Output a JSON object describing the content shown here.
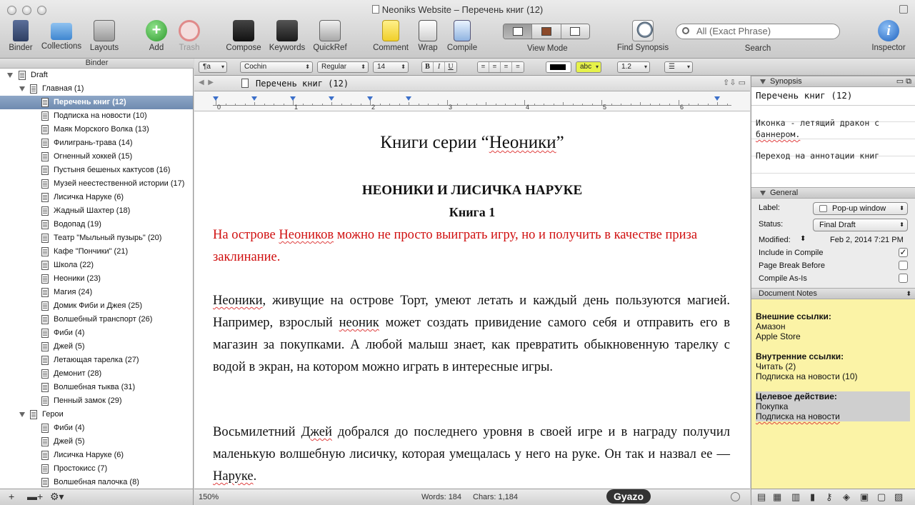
{
  "window": {
    "title": "Neoniks Website – Перечень книг (12)"
  },
  "toolbar": {
    "binder": "Binder",
    "collections": "Collections",
    "layouts": "Layouts",
    "add": "Add",
    "trash": "Trash",
    "compose": "Compose",
    "keywords": "Keywords",
    "quickref": "QuickRef",
    "comment": "Comment",
    "wrap": "Wrap",
    "compile": "Compile",
    "view_mode": "View Mode",
    "find_synopsis": "Find Synopsis",
    "search_placeholder": "All (Exact Phrase)",
    "search": "Search",
    "inspector": "Inspector"
  },
  "binder": {
    "header": "Binder",
    "draft": "Draft",
    "main_folder": "Главная (1)",
    "items": [
      "Перечень книг (12)",
      "Подписка на новости (10)",
      "Маяк Морского Волка (13)",
      "Филигрань-трава (14)",
      "Огненный хоккей (15)",
      "Пустыня бешеных кактусов (16)",
      "Музей неестественной истории (17)",
      "Лисичка Наруке (6)",
      "Жадный Шахтер (18)",
      "Водопад (19)",
      "Театр \"Мыльный пузырь\" (20)",
      "Кафе \"Пончики\" (21)",
      "Школа (22)",
      "Неоники (23)",
      "Магия (24)",
      "Домик Фиби и Джея (25)",
      "Волшебный транспорт (26)",
      "Фиби (4)",
      "Джей (5)",
      "Летающая тарелка (27)",
      "Демонит (28)",
      "Волшебная тыква (31)",
      "Пенный замок (29)"
    ],
    "heroes_folder": "Герои",
    "heroes": [
      "Фиби (4)",
      "Джей (5)",
      "Лисичка Наруке (6)",
      "Простокисс (7)",
      "Волшебная палочка (8)"
    ]
  },
  "formatbar": {
    "style": "¶a",
    "font": "Cochin",
    "weight": "Regular",
    "size": "14",
    "bold": "B",
    "italic": "I",
    "underline": "U",
    "highlight": "abc",
    "spacing": "1.2"
  },
  "editor": {
    "doc_title": "Перечень книг (12)",
    "ruler": [
      "0",
      "1",
      "2",
      "3",
      "4",
      "5",
      "6"
    ],
    "heading": "Книги серии “Неоники”",
    "heading_pre": "Книги серии “",
    "heading_word": "Неоники",
    "heading_post": "”",
    "book_title": "НЕОНИКИ И ЛИСИЧКА НАРУКЕ",
    "book_num": "Книга 1",
    "red_pre": "На острове ",
    "red_word": "Неоников",
    "red_post": " можно не просто выиграть игру, но и получить в качестве приза заклинание.",
    "p1_word1": "Неоники",
    "p1_a": ", живущие на острове Торт, умеют летать и каждый день пользуются магией. Например, взрослый ",
    "p1_word2": "неоник",
    "p1_b": "  может создать привидение самого себя и отправить его в магазин за покупками. А любой малыш знает, как превратить обыкновенную тарелку с водой в экран, на котором можно играть в интересные игры.",
    "p2_a": "Восьмилетний ",
    "p2_word1": "Джей",
    "p2_b": " добрался до последнего уровня в своей игре и в награду получил маленькую волшебную лисичку, которая умещалась у него на руке. Он так и назвал ее — ",
    "p2_word2": "Наруке",
    "p2_c": ".",
    "zoom": "150%",
    "words": "Words: 184",
    "chars": "Chars: 1,184"
  },
  "inspector": {
    "synopsis_header": "Synopsis",
    "synopsis_title": "Перечень книг (12)",
    "synopsis_line1": "Иконка - летящий дракон с",
    "synopsis_line2": "баннером.",
    "synopsis_line3": "Переход на аннотации книг",
    "general_header": "General",
    "label_key": "Label:",
    "label_val": "Pop-up window",
    "status_key": "Status:",
    "status_val": "Final Draft",
    "modified_key": "Modified:",
    "modified_val": "Feb 2, 2014 7:21 PM",
    "include_compile": "Include in Compile",
    "page_break": "Page Break Before",
    "compile_as_is": "Compile As-Is",
    "notes_header": "Document Notes",
    "ext_links": "Внешние ссылки:",
    "amazon": "Амазон",
    "apple": "Apple Store",
    "int_links": "Внутренние ссылки:",
    "read": "Читать (2)",
    "subscribe10": "Подписка на новости (10)",
    "target": "Целевое действие:",
    "purchase": "Покупка",
    "subscribe": "Подписка на новости"
  },
  "gyazo": "Gyazo",
  "colors": {
    "selection": "#7a95ba",
    "red_text": "#d01010",
    "notes_bg": "#fbf3a6",
    "highlight": "#e6f24a"
  }
}
